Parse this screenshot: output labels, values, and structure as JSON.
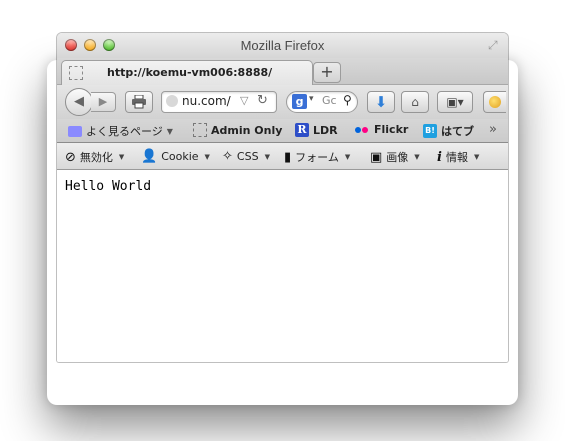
{
  "window": {
    "title": "Mozilla Firefox"
  },
  "tab": {
    "label": "http://koemu-vm006:8888/"
  },
  "newtab": {
    "label": "+"
  },
  "navbar": {
    "url_visible": "nu.com/",
    "search_placeholder": "Gc",
    "search_engine_icon": "g",
    "icons": [
      "back-icon",
      "forward-icon",
      "print-icon",
      "globe-icon",
      "reload-icon",
      "search-icon",
      "download-icon",
      "home-icon",
      "bookmark-icon",
      "addon-icon"
    ]
  },
  "bookmarks": {
    "items": [
      {
        "label": "よく見るページ",
        "icon": "smart-folder-icon",
        "has_dropdown": true
      },
      {
        "label": "Admin Only",
        "icon": "page-icon"
      },
      {
        "label": "LDR",
        "icon": "ldr-icon"
      },
      {
        "label": "Flickr",
        "icon": "flickr-icon"
      },
      {
        "label": "はてブ",
        "icon": "hatena-icon"
      }
    ],
    "more": "»"
  },
  "devtoolbar": {
    "items": [
      {
        "label": "無効化",
        "icon": "disable-icon"
      },
      {
        "label": "Cookie",
        "icon": "cookie-icon"
      },
      {
        "label": "CSS",
        "icon": "css-icon"
      },
      {
        "label": "フォーム",
        "icon": "form-icon"
      },
      {
        "label": "画像",
        "icon": "image-icon"
      },
      {
        "label": "情報",
        "icon": "info-icon"
      }
    ]
  },
  "page": {
    "body_text": "Hello World"
  }
}
